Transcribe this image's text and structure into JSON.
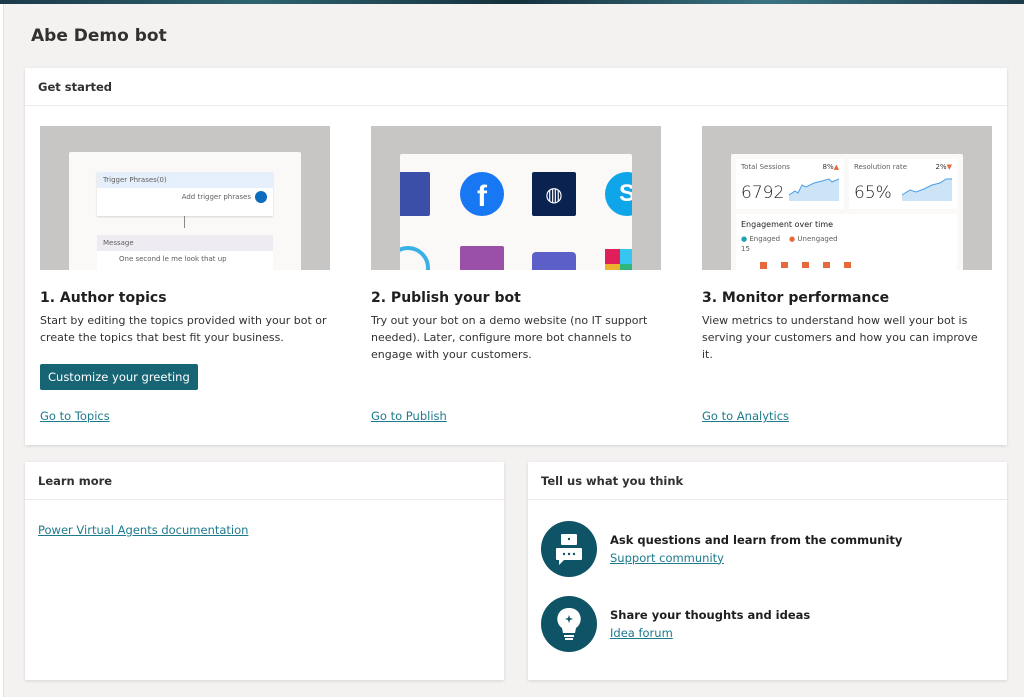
{
  "page_title": "Abe Demo bot",
  "get_started": {
    "title": "Get started",
    "columns": [
      {
        "heading": "1. Author topics",
        "desc": "Start by editing the topics provided with your bot or create the topics that best fit your business.",
        "button": "Customize your greeting",
        "link": "Go to Topics",
        "preview": {
          "trigger": "Trigger Phrases(0)",
          "add": "Add trigger phrases",
          "message": "Message",
          "msg_text": "One second le me look that up"
        }
      },
      {
        "heading": "2. Publish your bot",
        "desc": "Try out your bot on a demo website (no IT support needed). Later, configure more bot channels to engage with your customers.",
        "link": "Go to Publish"
      },
      {
        "heading": "3. Monitor performance",
        "desc": "View metrics to understand how well your bot is serving your customers and how you can improve it.",
        "link": "Go to Analytics",
        "preview": {
          "sessions_label": "Total Sessions",
          "sessions_change": "8%",
          "sessions": "6792",
          "resolution_label": "Resolution rate",
          "resolution_change": "2%",
          "resolution": "65%",
          "engagement": "Engagement over time",
          "engaged": "Engaged",
          "unengaged": "Unengaged",
          "y_tick": "15"
        }
      }
    ]
  },
  "learn_more": {
    "title": "Learn more",
    "link": "Power Virtual Agents documentation"
  },
  "feedback": {
    "title": "Tell us what you think",
    "items": [
      {
        "heading": "Ask questions and learn from the community",
        "link": "Support community",
        "icon": "chat-icon"
      },
      {
        "heading": "Share your thoughts and ideas",
        "link": "Idea forum",
        "icon": "lightbulb-icon"
      }
    ]
  },
  "colors": {
    "accent": "#176475",
    "link": "#1d7a8c",
    "icon_bg": "#0f5366"
  }
}
